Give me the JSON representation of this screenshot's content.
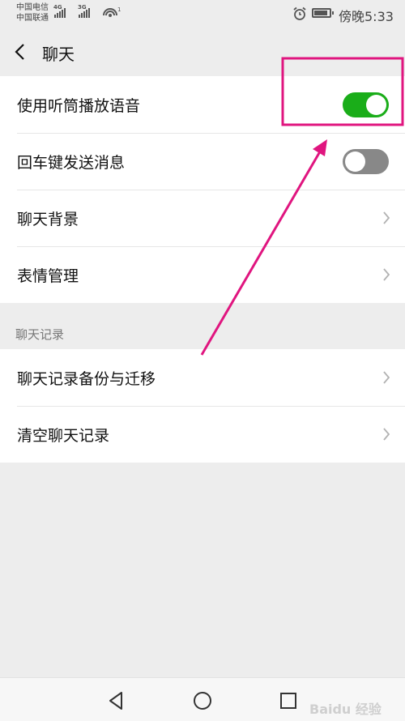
{
  "status_bar": {
    "carrier_1": "中国电信",
    "carrier_2": "中国联通",
    "network_1": "4G",
    "network_2": "3G",
    "wifi_badge": "1",
    "time": "傍晚5:33"
  },
  "header": {
    "title": "聊天"
  },
  "settings_group_1": {
    "items": [
      {
        "label": "使用听筒播放语音",
        "control": "toggle",
        "enabled": true
      },
      {
        "label": "回车键发送消息",
        "control": "toggle",
        "enabled": false
      },
      {
        "label": "聊天背景",
        "control": "chevron"
      },
      {
        "label": "表情管理",
        "control": "chevron"
      }
    ]
  },
  "section_chat_history": {
    "label": "聊天记录",
    "items": [
      {
        "label": "聊天记录备份与迁移",
        "control": "chevron"
      },
      {
        "label": "清空聊天记录",
        "control": "chevron"
      }
    ]
  },
  "colors": {
    "toggle_on": "#1aad19",
    "toggle_off": "#888888",
    "annotation": "#e0157f",
    "background": "#ededed"
  },
  "watermark": "Baidu 经验"
}
